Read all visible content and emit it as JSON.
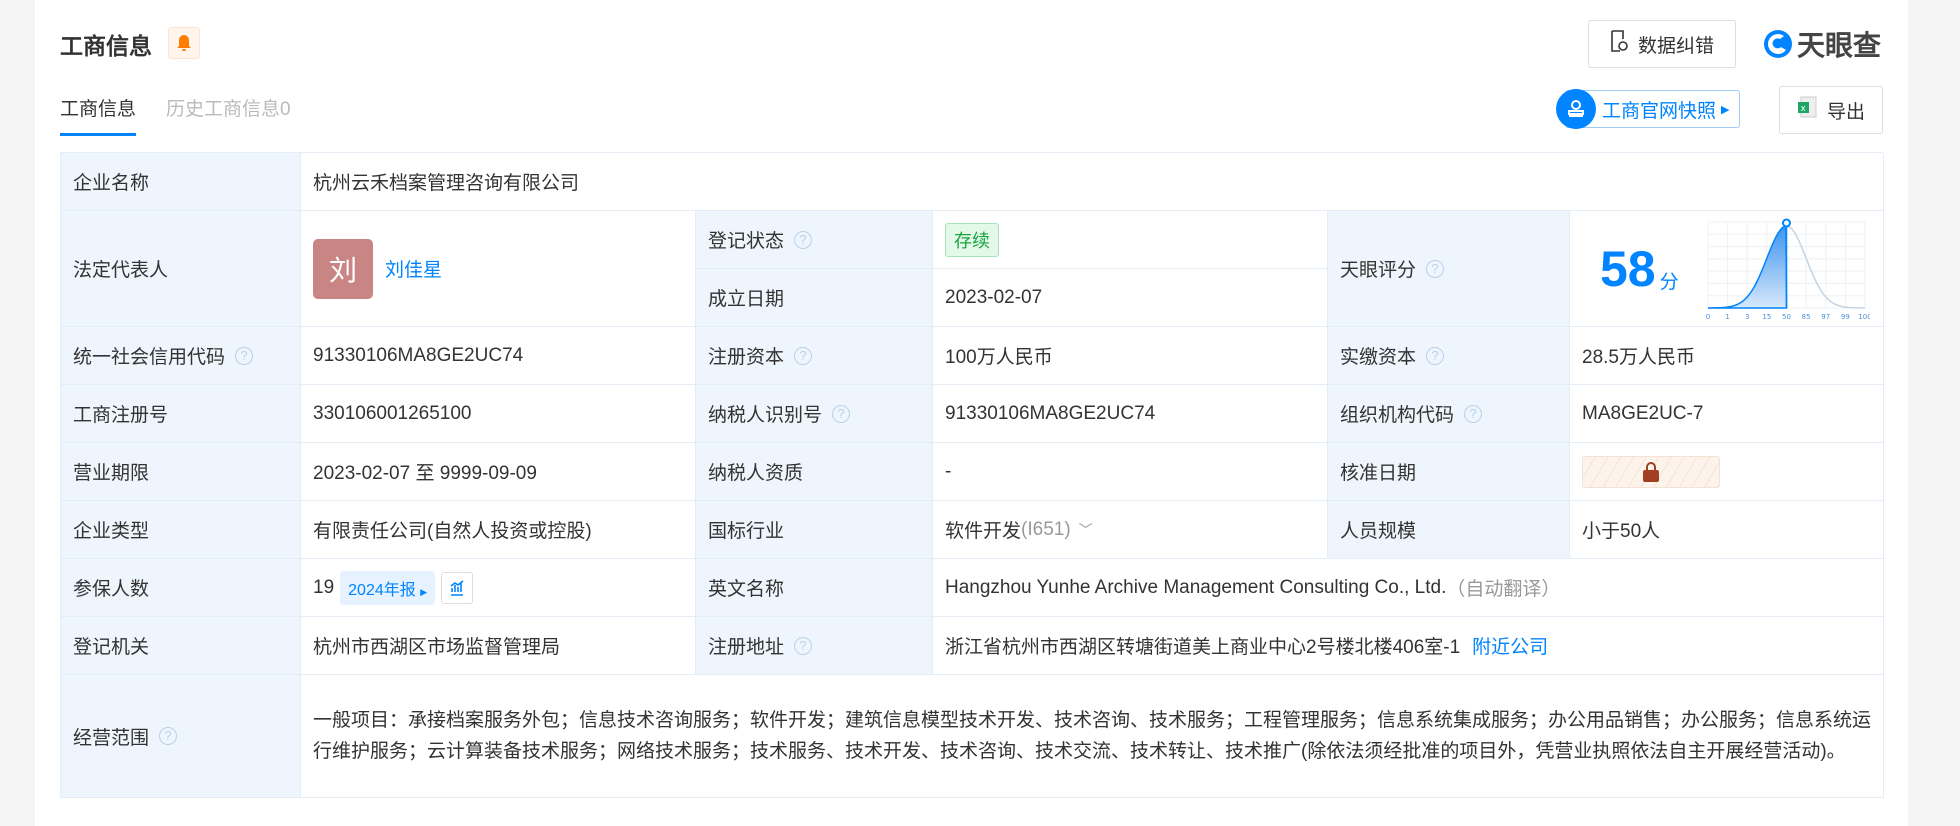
{
  "header": {
    "title": "工商信息",
    "correct_btn": "数据纠错",
    "logo": "天眼查",
    "snapshot_btn": "工商官网快照",
    "export_btn": "导出"
  },
  "tabs": [
    {
      "label": "工商信息"
    },
    {
      "label": "历史工商信息0"
    }
  ],
  "rows": {
    "company_name": {
      "label": "企业名称",
      "value": "杭州云禾档案管理咨询有限公司"
    },
    "legal_rep": {
      "label": "法定代表人",
      "avatar": "刘",
      "value": "刘佳星"
    },
    "status": {
      "label": "登记状态",
      "value": "存续"
    },
    "founded": {
      "label": "成立日期",
      "value": "2023-02-07"
    },
    "score": {
      "label": "天眼评分",
      "value": "58",
      "unit": "分",
      "ticks": [
        "0",
        "1",
        "3",
        "15",
        "50",
        "85",
        "97",
        "99",
        "100"
      ],
      "percentile": 50
    },
    "credit_code": {
      "label": "统一社会信用代码",
      "value": "91330106MA8GE2UC74"
    },
    "reg_capital": {
      "label": "注册资本",
      "value": "100万人民币"
    },
    "paid_capital": {
      "label": "实缴资本",
      "value": "28.5万人民币"
    },
    "reg_no": {
      "label": "工商注册号",
      "value": "330106001265100"
    },
    "taxpayer_id": {
      "label": "纳税人识别号",
      "value": "91330106MA8GE2UC74"
    },
    "org_code": {
      "label": "组织机构代码",
      "value": "MA8GE2UC-7"
    },
    "term": {
      "label": "营业期限",
      "value": "2023-02-07 至 9999-09-09"
    },
    "taxpayer_qual": {
      "label": "纳税人资质",
      "value": "-"
    },
    "approve_date": {
      "label": "核准日期"
    },
    "type": {
      "label": "企业类型",
      "value": "有限责任公司(自然人投资或控股)"
    },
    "industry": {
      "label": "国标行业",
      "value": "软件开发",
      "code": "(I651)"
    },
    "staff": {
      "label": "人员规模",
      "value": "小于50人"
    },
    "insured": {
      "label": "参保人数",
      "value": "19",
      "report": "2024年报"
    },
    "en_name": {
      "label": "英文名称",
      "value": "Hangzhou Yunhe Archive Management Consulting Co., Ltd.",
      "note": "（自动翻译）"
    },
    "authority": {
      "label": "登记机关",
      "value": "杭州市西湖区市场监督管理局"
    },
    "address": {
      "label": "注册地址",
      "value": "浙江省杭州市西湖区转塘街道美上商业中心2号楼北楼406室-1",
      "link": "附近公司"
    },
    "scope": {
      "label": "经营范围",
      "value": "一般项目：承接档案服务外包；信息技术咨询服务；软件开发；建筑信息模型技术开发、技术咨询、技术服务；工程管理服务；信息系统集成服务；办公用品销售；办公服务；信息系统运行维护服务；云计算装备技术服务；网络技术服务；技术服务、技术开发、技术咨询、技术交流、技术转让、技术推广(除依法须经批准的项目外，凭营业执照依法自主开展经营活动)。"
    }
  }
}
